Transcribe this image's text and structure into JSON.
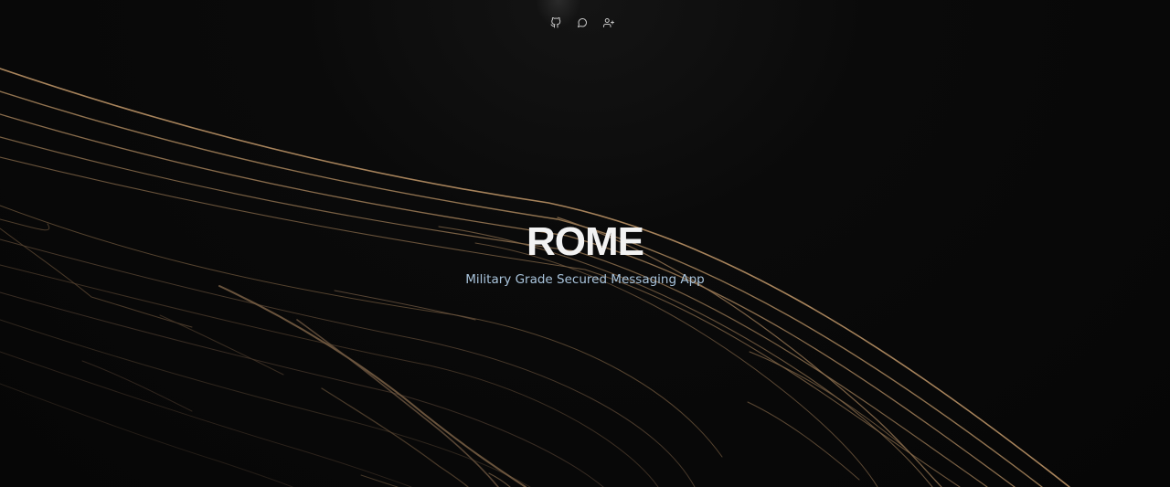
{
  "nav": {
    "items": [
      {
        "icon": "github-icon"
      },
      {
        "icon": "chat-bubble-icon"
      },
      {
        "icon": "user-plus-icon"
      }
    ]
  },
  "hero": {
    "title": "ROME",
    "subtitle": "Military Grade Secured Messaging App"
  },
  "colors": {
    "background": "#070707",
    "line_bright": "#b08a60",
    "line_dim": "#5e4a34",
    "title": "#f2f2f2",
    "subtitle": "#a9c4dc",
    "icon": "#c8c8c8"
  }
}
